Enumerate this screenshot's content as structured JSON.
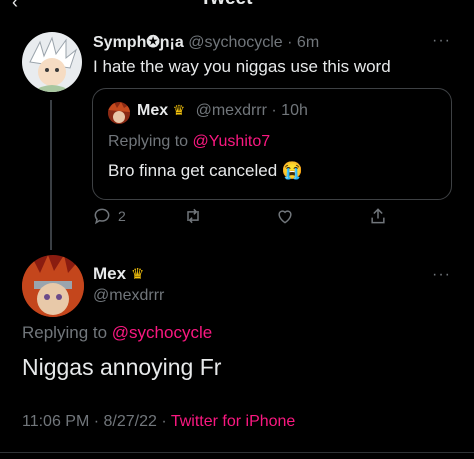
{
  "header": {
    "title": "Tweet"
  },
  "tweet1": {
    "display_name": "Symph✪ɲ¡a",
    "handle": "@sychocycle",
    "time": "· 6m",
    "text": "I hate the way you niggas use this word",
    "quote": {
      "display_name": "Mex",
      "handle": "@mexdrrr",
      "time": "· 10h",
      "replying_prefix": "Replying to",
      "replying_handle": "@Yushito7",
      "text": "Bro finna get canceled 😭"
    },
    "actions": {
      "replies": "2"
    }
  },
  "tweet2": {
    "display_name": "Mex",
    "handle": "@mexdrrr",
    "replying_prefix": "Replying to",
    "replying_handle": "@sychocycle",
    "text": "Niggas annoying Fr",
    "timestamp": "11:06 PM · 8/27/22 ·",
    "source": "Twitter for iPhone"
  },
  "colors": {
    "accent": "#f91880",
    "muted": "#71767b",
    "text": "#e7e9ea",
    "border": "#3e4144"
  }
}
